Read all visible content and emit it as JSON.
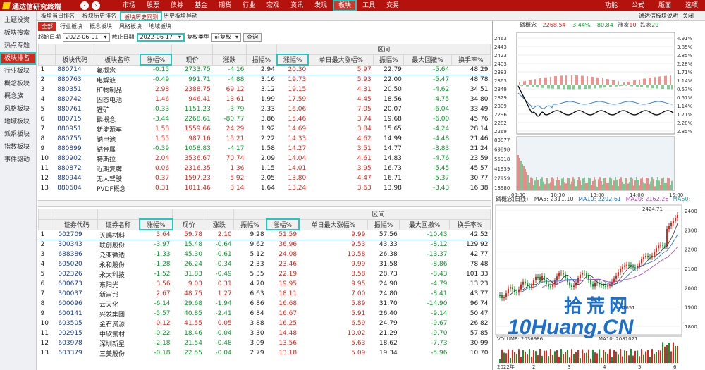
{
  "app": {
    "title": "通达信研究终端",
    "nav_prev": "‹",
    "nav_next": "›",
    "menus": [
      "市场",
      "股票",
      "债券",
      "基金",
      "期货",
      "行业",
      "宏观",
      "资讯",
      "发现",
      "板块",
      "工具",
      "交易"
    ],
    "active_menu": "板块",
    "right_menus": [
      "功能",
      "公式",
      "版面",
      "选项"
    ]
  },
  "subtabs": [
    "板块当日排名",
    "板块历史排名",
    "板块历史回测",
    "历史板块异动"
  ],
  "active_subtab": "板块历史回测",
  "side": [
    "主题投资",
    "板块搜索",
    "热点专题",
    "板块排名",
    "行业板块",
    "概念板块",
    "概念族",
    "风格板块",
    "地域板块",
    "派系板块",
    "指数板块",
    "事件驱动"
  ],
  "active_side": "板块排名",
  "row2": [
    "全部",
    "行业板块",
    "概念板块",
    "风格板块",
    "地域板块"
  ],
  "filter": {
    "start_label": "起始日期",
    "start": "2022-06-01",
    "end_label": "截止日期",
    "end": "2022-06-17",
    "adj_label": "复权类型",
    "adj": "前复权",
    "query": "查询",
    "drop": "▾"
  },
  "table1": {
    "region_label": "区间",
    "headers": [
      "",
      "板块代码",
      "板块名称",
      "涨幅%",
      "现价",
      "涨跌",
      "振幅%",
      "涨幅%",
      "单日最大涨幅%",
      "振幅%",
      "最大回撤%",
      "换手率%"
    ],
    "rows": [
      [
        "1",
        "880714",
        "氟概念",
        "-0.15",
        "2733.75",
        "-4.16",
        "2.94",
        "20.30",
        "5.97",
        "22.79",
        "-5.64",
        "48.29"
      ],
      [
        "2",
        "880763",
        "电解液",
        "-0.49",
        "991.71",
        "-4.88",
        "3.16",
        "19.73",
        "5.93",
        "22.00",
        "-5.47",
        "48.78"
      ],
      [
        "3",
        "880351",
        "矿物制品",
        "2.98",
        "2388.75",
        "69.12",
        "3.12",
        "19.15",
        "4.31",
        "20.50",
        "-4.62",
        "34.51"
      ],
      [
        "4",
        "880742",
        "固态电池",
        "1.46",
        "946.41",
        "13.61",
        "1.99",
        "17.59",
        "4.45",
        "18.56",
        "-4.75",
        "34.80"
      ],
      [
        "5",
        "880761",
        "锂矿",
        "-0.33",
        "1151.23",
        "-3.79",
        "2.33",
        "16.06",
        "7.05",
        "20.07",
        "-6.04",
        "33.49"
      ],
      [
        "6",
        "880715",
        "磷概念",
        "-3.44",
        "2268.61",
        "-80.77",
        "3.86",
        "15.46",
        "3.74",
        "19.68",
        "-6.00",
        "45.76"
      ],
      [
        "7",
        "880951",
        "新能源车",
        "1.58",
        "1559.66",
        "24.29",
        "1.92",
        "14.69",
        "3.84",
        "15.65",
        "-4.24",
        "28.14"
      ],
      [
        "8",
        "880755",
        "钠电池",
        "1.55",
        "987.16",
        "15.21",
        "2.22",
        "14.33",
        "4.62",
        "14.99",
        "-4.48",
        "21.46"
      ],
      [
        "9",
        "880899",
        "钴金属",
        "-0.39",
        "1058.83",
        "-4.17",
        "1.58",
        "14.27",
        "3.51",
        "14.77",
        "-3.83",
        "21.24"
      ],
      [
        "10",
        "880902",
        "特斯拉",
        "2.04",
        "3536.67",
        "70.74",
        "2.09",
        "14.04",
        "4.61",
        "14.83",
        "-4.76",
        "23.59"
      ],
      [
        "11",
        "880872",
        "近期复牌",
        "0.06",
        "2316.35",
        "1.36",
        "1.15",
        "14.01",
        "3.95",
        "16.73",
        "-5.45",
        "45.57"
      ],
      [
        "12",
        "880944",
        "无人驾驶",
        "0.37",
        "1597.23",
        "5.92",
        "2.05",
        "13.80",
        "4.47",
        "16.71",
        "-5.37",
        "30.77"
      ],
      [
        "13",
        "880604",
        "PVDF概念",
        "0.31",
        "1011.46",
        "3.14",
        "1.64",
        "13.24",
        "3.63",
        "13.98",
        "-3.43",
        "16.38"
      ]
    ]
  },
  "table2": {
    "region_label": "区间",
    "headers": [
      "",
      "证券代码",
      "证券名称",
      "涨幅%",
      "现价",
      "涨跌",
      "振幅%",
      "涨幅%",
      "单日最大涨幅%",
      "振幅%",
      "最大回撤%",
      "换手率%"
    ],
    "rows": [
      [
        "1",
        "002709",
        "天赐材料",
        "3.64",
        "59.78",
        "2.10",
        "9.28",
        "51.59",
        "9.99",
        "57.56",
        "-10.43",
        "42.52"
      ],
      [
        "2",
        "300343",
        "联创股份",
        "-3.97",
        "15.48",
        "-0.64",
        "9.62",
        "36.96",
        "9.53",
        "43.33",
        "-8.12",
        "129.92"
      ],
      [
        "3",
        "688386",
        "泛亚微透",
        "-1.33",
        "45.30",
        "-0.61",
        "5.12",
        "24.08",
        "10.58",
        "26.38",
        "-13.37",
        "42.77"
      ],
      [
        "4",
        "605020",
        "永和股份",
        "-1.28",
        "26.24",
        "-0.34",
        "2.33",
        "23.46",
        "9.99",
        "31.58",
        "-8.86",
        "78.48"
      ],
      [
        "5",
        "002326",
        "永太科技",
        "-1.52",
        "31.83",
        "-0.49",
        "5.35",
        "22.19",
        "8.58",
        "28.73",
        "-8.43",
        "101.33"
      ],
      [
        "6",
        "600673",
        "东阳光",
        "3.56",
        "9.03",
        "0.31",
        "4.70",
        "19.95",
        "9.95",
        "24.90",
        "-4.79",
        "13.23"
      ],
      [
        "7",
        "300037",
        "新宙邦",
        "2.67",
        "48.75",
        "1.27",
        "6.63",
        "18.11",
        "7.00",
        "24.80",
        "-8.41",
        "43.77"
      ],
      [
        "8",
        "600096",
        "云天化",
        "-6.14",
        "29.68",
        "-1.94",
        "6.86",
        "16.68",
        "5.89",
        "31.70",
        "-14.90",
        "96.74"
      ],
      [
        "9",
        "600141",
        "兴发集团",
        "-5.57",
        "40.85",
        "-2.41",
        "6.84",
        "16.67",
        "5.91",
        "26.40",
        "-9.14",
        "50.47"
      ],
      [
        "10",
        "603505",
        "金石资源",
        "0.12",
        "41.55",
        "0.05",
        "3.88",
        "16.25",
        "6.59",
        "24.79",
        "-9.67",
        "26.82"
      ],
      [
        "11",
        "002915",
        "中欣氟材",
        "-0.22",
        "18.46",
        "-0.04",
        "3.30",
        "14.48",
        "10.02",
        "21.29",
        "-9.70",
        "57.85"
      ],
      [
        "12",
        "603978",
        "深圳新星",
        "-2.18",
        "21.54",
        "-0.48",
        "3.09",
        "13.56",
        "5.63",
        "18.62",
        "-7.73",
        "30.99"
      ],
      [
        "13",
        "603379",
        "三美股份",
        "-0.18",
        "22.55",
        "-0.04",
        "2.79",
        "13.18",
        "5.09",
        "19.34",
        "-5.96",
        "10.70"
      ]
    ]
  },
  "right": {
    "board_name": "磷概念",
    "price": "2268.54",
    "chg": "-3.44%",
    "chg_abs": "-80.84",
    "rise_label": "涨家",
    "rise": "10",
    "fall_label": "跌家",
    "fall": "29",
    "prices_left": [
      "2463",
      "2443",
      "2423",
      "2403",
      "2383",
      "2363",
      "2349",
      "2329",
      "2309",
      "2296",
      "2282",
      "2269"
    ],
    "pct_right": [
      "4.91%",
      "3.85%",
      "2.85%",
      "2.28%",
      "1.71%",
      "1.14%",
      "0.57%",
      "0.57%",
      "1.14%",
      "1.71%",
      "2.28%",
      "2.85%"
    ],
    "vol_ticks": [
      "83877",
      "69898",
      "55918",
      "41939",
      "27959",
      "13980"
    ],
    "time_ticks": [
      "09:30",
      "10:30",
      "13:00",
      "14:00",
      "15:00"
    ],
    "kline_label": "磷概念(日线)",
    "ma5": "MA5: 2311.10",
    "ma10": "MA10: 2292.61",
    "ma20": "MA20: 2162.26",
    "ma60": "MA60:",
    "kline_high": "2424.71",
    "kline_ticks": [
      "2400",
      "2300",
      "2200",
      "2100",
      "2000",
      "1900",
      "1800"
    ],
    "kline_low": "1651",
    "vol_label": "VOLUME: 2036986",
    "vol_ma": "MA10: 2081021",
    "date_ticks": [
      "2022年",
      "2",
      "3",
      "4",
      "5",
      "6"
    ],
    "topbar": "通达信板块说明",
    "close": "关闭"
  },
  "watermark": {
    "cn": "拾荒网",
    "en": "10Huang.CN"
  },
  "colors": {
    "red": "#e0251b",
    "green": "#0b9a2a",
    "accent": "#b3120d",
    "cyan": "#22c8c0"
  }
}
